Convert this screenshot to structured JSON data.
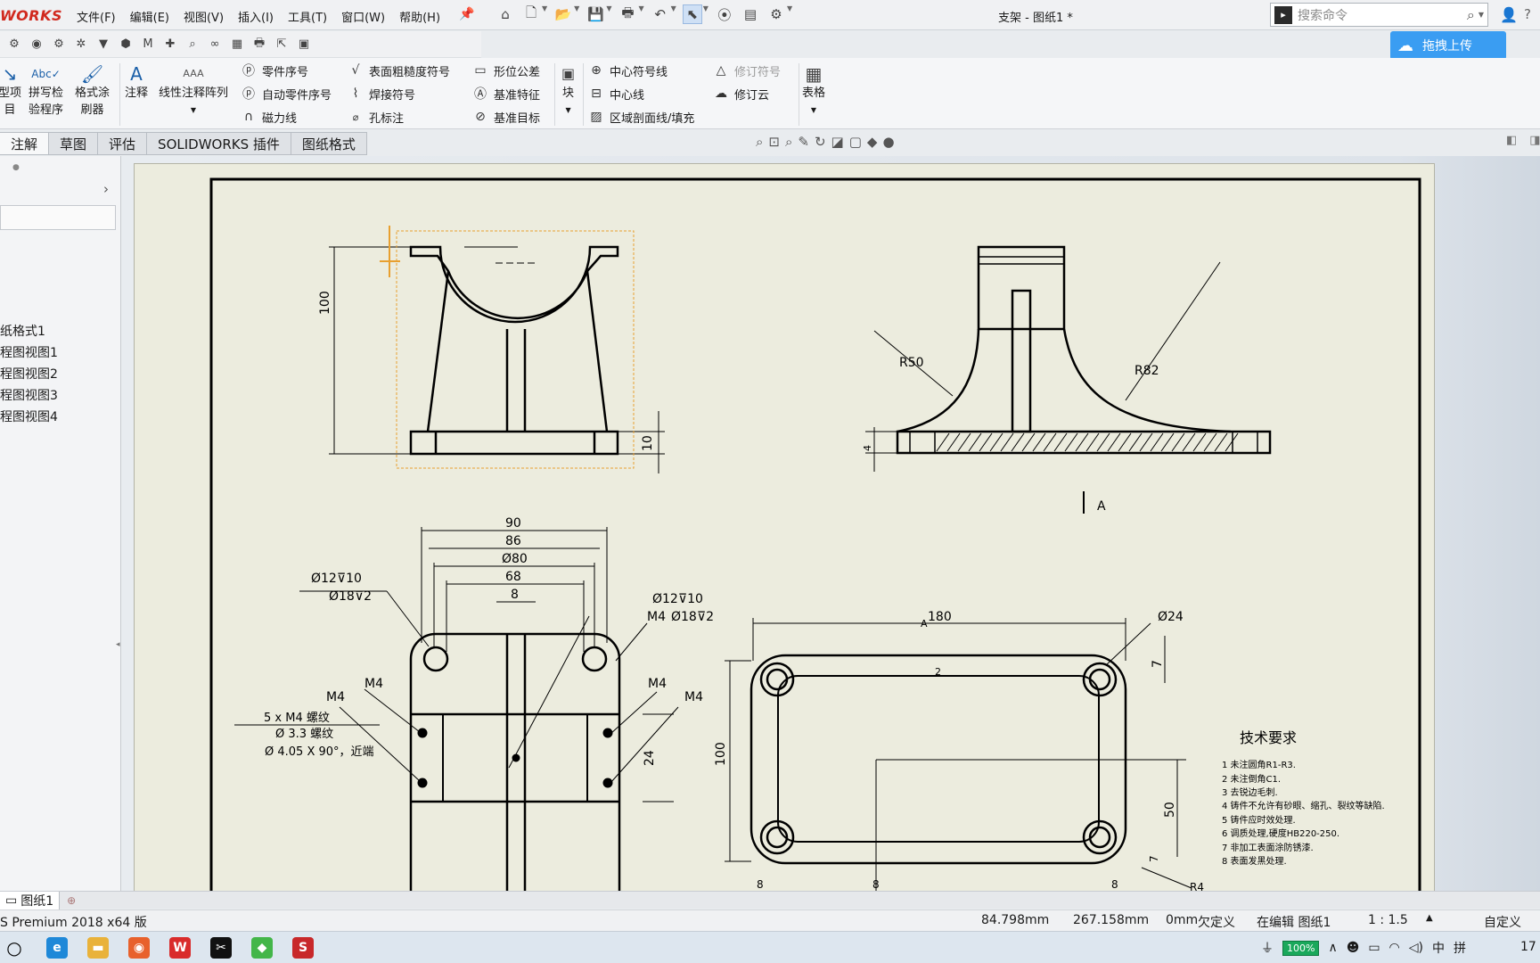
{
  "app": {
    "logo": "WORKS",
    "doc_title": "支架 - 图纸1 *"
  },
  "menu": [
    "文件(F)",
    "编辑(E)",
    "视图(V)",
    "插入(I)",
    "工具(T)",
    "窗口(W)",
    "帮助(H)"
  ],
  "search": {
    "placeholder": "搜索命令"
  },
  "upload": {
    "label": "拖拽上传"
  },
  "ribbon": {
    "model_items": {
      "l1": "型项",
      "l2": "目"
    },
    "spell": {
      "l1": "拼写检",
      "l2": "验程序"
    },
    "format": {
      "l1": "格式涂",
      "l2": "刷器"
    },
    "note": "注释",
    "linear_pattern": "线性注释阵列",
    "balloon": "零件序号",
    "auto_balloon": "自动零件序号",
    "magnetic": "磁力线",
    "surface": "表面粗糙度符号",
    "weld": "焊接符号",
    "hole": "孔标注",
    "gtol": "形位公差",
    "datum_feature": "基准特征",
    "datum_target": "基准目标",
    "block": "块",
    "center_mark": "中心符号线",
    "centerline": "中心线",
    "hatch": "区域剖面线/填充",
    "revision_symbol": "修订符号",
    "revision_cloud": "修订云",
    "table": "表格"
  },
  "tabs": [
    "注解",
    "草图",
    "评估",
    "SOLIDWORKS 插件",
    "图纸格式"
  ],
  "tree": [
    "纸格式1",
    "程图视图1",
    "程图视图2",
    "程图视图3",
    "程图视图4"
  ],
  "drawing": {
    "top_left": {
      "d100": "100",
      "d10": "10"
    },
    "top_right": {
      "r50": "R50",
      "r82": "R82",
      "d4": "4",
      "arrow_a": "A"
    },
    "bottom_left": {
      "d90": "90",
      "d86": "86",
      "d80": "Ø80",
      "d68": "68",
      "d8": "8",
      "hole1a": "Ø12⊽10",
      "hole1b": "Ø18⊽2",
      "hole2a": "Ø12⊽10",
      "hole2b": "Ø18⊽2",
      "m4box": "M4",
      "m4a": "M4",
      "m4b": "M4",
      "m4c": "M4",
      "m4d": "M4",
      "tap1": "5 x  M4  螺纹",
      "tap2": "Ø  3.3  螺纹",
      "tap3": "Ø  4.05 X 90°，近端",
      "d24": "24"
    },
    "bottom_right": {
      "d180": "180",
      "dA": "A",
      "d24": "Ø24",
      "d7": "7",
      "d2": "2",
      "d100": "100",
      "d50": "50",
      "d8a": "8",
      "d8b": "8",
      "d8c": "8",
      "r4": "R4",
      "d7b": "7"
    },
    "notes": {
      "title": "技术要求",
      "items": [
        "1  未注圆角R1-R3.",
        "2  未注倒角C1.",
        "3  去锐边毛刺.",
        "4  铸件不允许有砂眼、缩孔、裂纹等缺陷.",
        "5  铸件应时效处理.",
        "6  调质处理,硬度HB220-250.",
        "7  非加工表面涂防锈漆.",
        "8  表面发黑处理."
      ]
    }
  },
  "sheet_tab": "图纸1",
  "status": {
    "version": "S Premium 2018 x64 版",
    "x": "84.798mm",
    "y": "267.158mm",
    "z": "0mm",
    "defined": "欠定义",
    "editing": "在编辑 图纸1",
    "scale": "1 : 1.5",
    "custom": "自定义"
  },
  "taskbar": {
    "battery": "100%",
    "ime1": "中",
    "ime2": "拼",
    "clock": "17"
  },
  "colors": {
    "accent": "#1f6fc9",
    "upload": "#3a9df2",
    "paper": "#ececde",
    "selection": "#e8a030"
  }
}
